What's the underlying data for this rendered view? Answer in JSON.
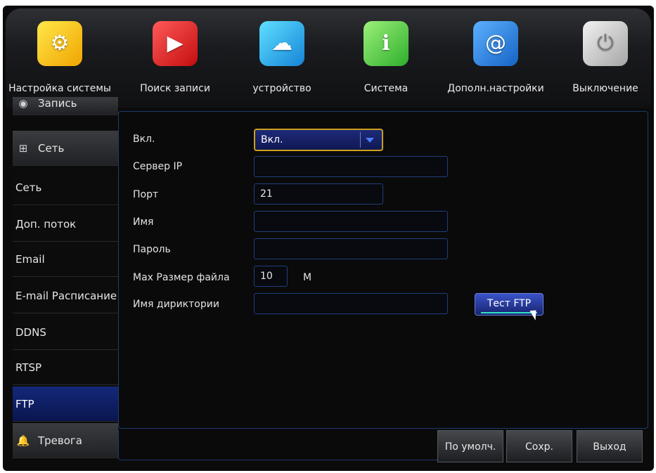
{
  "topnav": {
    "items": [
      {
        "label": "Настройка системы",
        "icon": "settings-gears-icon"
      },
      {
        "label": "Поиск записи",
        "icon": "record-search-icon"
      },
      {
        "label": "устройство",
        "icon": "device-cloud-storage-icon"
      },
      {
        "label": "Система",
        "icon": "system-info-icon"
      },
      {
        "label": "Дополн.настройки",
        "icon": "advanced-settings-email-icon"
      },
      {
        "label": "Выключение",
        "icon": "power-icon"
      }
    ]
  },
  "sidebar": {
    "items": [
      {
        "label": "Запись",
        "icon": "record-icon"
      },
      {
        "label": "Сеть",
        "icon": "network-icon"
      },
      {
        "label": "Сеть"
      },
      {
        "label": "Доп. поток"
      },
      {
        "label": "Email"
      },
      {
        "label": "E-mail Расписание"
      },
      {
        "label": "DDNS"
      },
      {
        "label": "RTSP"
      },
      {
        "label": "FTP"
      },
      {
        "label": "Тревога",
        "icon": "alarm-bell-icon"
      }
    ],
    "active": "FTP"
  },
  "form": {
    "enable_label": "Вкл.",
    "enable_value": "Вкл.",
    "server_ip_label": "Сервер IP",
    "server_ip_value": "",
    "port_label": "Порт",
    "port_value": "21",
    "username_label": "Имя",
    "username_value": "",
    "password_label": "Пароль",
    "password_value": "",
    "max_file_size_label": "Max Размер файла",
    "max_file_size_value": "10",
    "max_file_size_unit": "M",
    "directory_label": "Имя дириктории",
    "directory_value": "",
    "test_button": "Тест FTP"
  },
  "footer": {
    "default_button": "По умолч.",
    "save_button": "Сохр.",
    "exit_button": "Выход"
  },
  "colors": {
    "accent": "#1a2d8a",
    "select_border": "#c9a01c",
    "field_border": "#213e78",
    "background": "#0b0b0c"
  }
}
